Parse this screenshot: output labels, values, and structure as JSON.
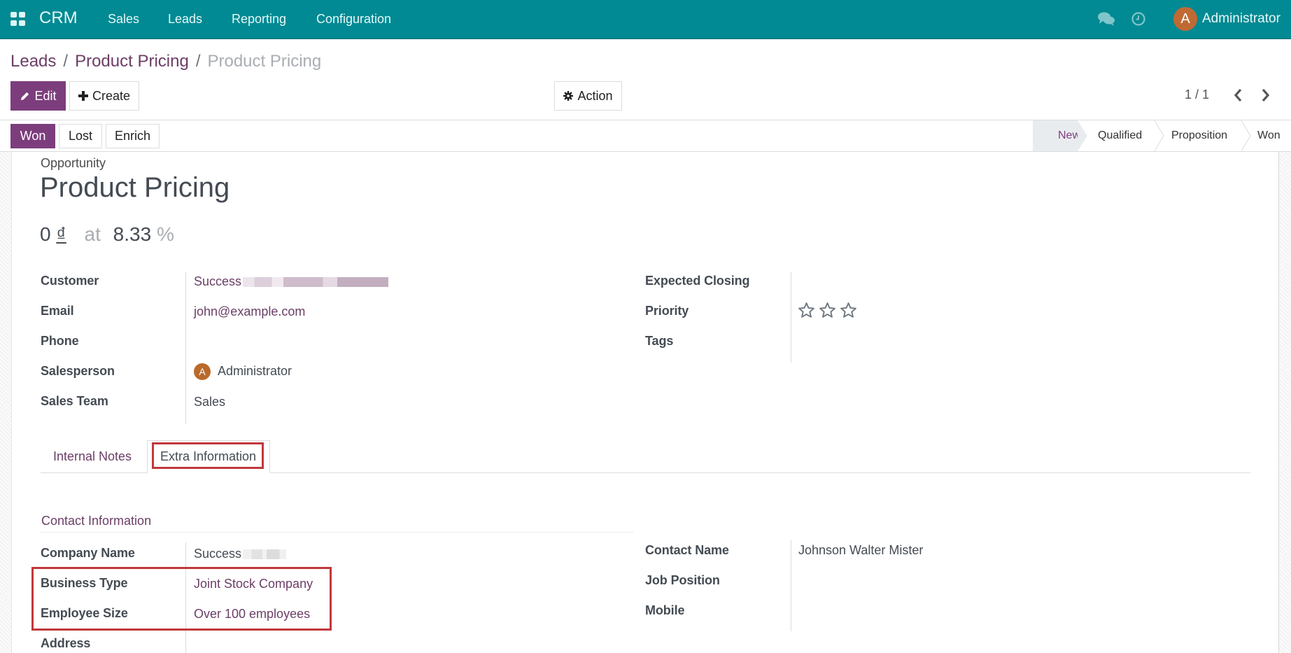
{
  "navbar": {
    "app_name": "CRM",
    "menus": [
      "Sales",
      "Leads",
      "Reporting",
      "Configuration"
    ],
    "icons": {
      "apps": "apps-grid-icon",
      "chat": "chat-bubbles-icon",
      "activity": "clock-icon"
    },
    "user": {
      "initial": "A",
      "name": "Administrator",
      "avatar_color": "#c06a33"
    },
    "color": "#018a93"
  },
  "breadcrumb": {
    "items": [
      "Leads",
      "Product Pricing"
    ],
    "current": "Product Pricing",
    "separator": "/"
  },
  "toolbar": {
    "edit_label": "Edit",
    "create_label": "Create",
    "action_label": "Action",
    "pager": "1 / 1"
  },
  "statusbar": {
    "buttons": [
      "Won",
      "Lost",
      "Enrich"
    ],
    "stages": [
      "New",
      "Qualified",
      "Proposition",
      "Won"
    ],
    "current_stage": "New"
  },
  "record": {
    "kind": "Opportunity",
    "title": "Product Pricing",
    "expected_revenue": "0",
    "currency": "₫",
    "at_label": "at",
    "probability": "8.33",
    "percent_sign": "%"
  },
  "fields_left": [
    {
      "label": "Customer",
      "value": "Success",
      "redacted": true
    },
    {
      "label": "Email",
      "value": "john@example.com"
    },
    {
      "label": "Phone",
      "value": ""
    },
    {
      "label": "Salesperson",
      "value": "Administrator",
      "avatar_initial": "A"
    },
    {
      "label": "Sales Team",
      "value": "Sales"
    }
  ],
  "fields_right": [
    {
      "label": "Expected Closing",
      "value": ""
    },
    {
      "label": "Priority",
      "stars_filled": 0,
      "stars_total": 3
    },
    {
      "label": "Tags",
      "value": ""
    }
  ],
  "tabs": [
    {
      "label": "Internal Notes",
      "active": false
    },
    {
      "label": "Extra Information",
      "active": true
    }
  ],
  "extra_info": {
    "section_title": "Contact Information",
    "left": [
      {
        "label": "Company Name",
        "value": "Success",
        "redacted": true
      },
      {
        "label": "Business Type",
        "value": "Joint Stock Company"
      },
      {
        "label": "Employee Size",
        "value": "Over 100 employees"
      },
      {
        "label": "Address",
        "value": ""
      }
    ],
    "right": [
      {
        "label": "Contact Name",
        "value": "Johnson Walter Mister"
      },
      {
        "label": "Job Position",
        "value": ""
      },
      {
        "label": "Mobile",
        "value": ""
      }
    ]
  },
  "highlight_color": "#c0393b",
  "accent_color": "#7c3d7d"
}
